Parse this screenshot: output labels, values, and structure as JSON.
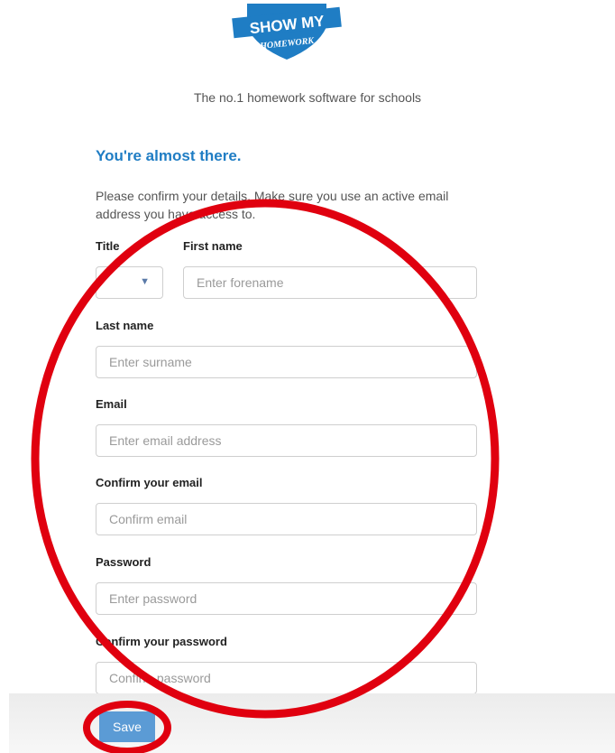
{
  "brand": {
    "logo_line1": "SHOW MY",
    "logo_line2": "HOMEWORK",
    "tagline": "The no.1 homework software for schools",
    "color": "#1f7dc4"
  },
  "form": {
    "heading": "You're almost there.",
    "intro": "Please confirm your details. Make sure you use an active email address you have access to.",
    "title_label": "Title",
    "title_value": "",
    "first_name_label": "First name",
    "first_name_placeholder": "Enter forename",
    "last_name_label": "Last name",
    "last_name_placeholder": "Enter surname",
    "email_label": "Email",
    "email_placeholder": "Enter email address",
    "confirm_email_label": "Confirm your email",
    "confirm_email_placeholder": "Confirm email",
    "password_label": "Password",
    "password_placeholder": "Enter password",
    "confirm_password_label": "Confirm your password",
    "confirm_password_placeholder": "Confirm password",
    "save_label": "Save"
  },
  "annotations": {
    "color": "#e0000f"
  }
}
